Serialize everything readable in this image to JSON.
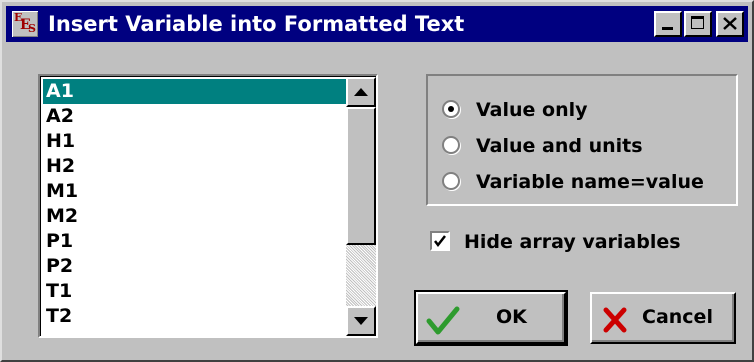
{
  "window": {
    "title": "Insert Variable into Formatted Text",
    "icon": "app-icon-ees",
    "icon_text": "EES",
    "controls": {
      "minimize": "minimize-icon",
      "maximize": "maximize-icon",
      "close": "close-icon"
    }
  },
  "variables": {
    "items": [
      "A1",
      "A2",
      "H1",
      "H2",
      "M1",
      "M2",
      "P1",
      "P2",
      "T1",
      "T2"
    ],
    "selected": "A1"
  },
  "format_options": {
    "options": [
      "Value only",
      "Value and units",
      "Variable name=value"
    ],
    "selected": "Value only"
  },
  "hide_array": {
    "label": "Hide array variables",
    "checked": true
  },
  "buttons": {
    "ok": "OK",
    "cancel": "Cancel"
  },
  "colors": {
    "titlebar": "#000080",
    "selection": "#008080",
    "face": "#c0c0c0",
    "ok_check": "#2e9b2e",
    "cancel_x": "#cc0000"
  }
}
